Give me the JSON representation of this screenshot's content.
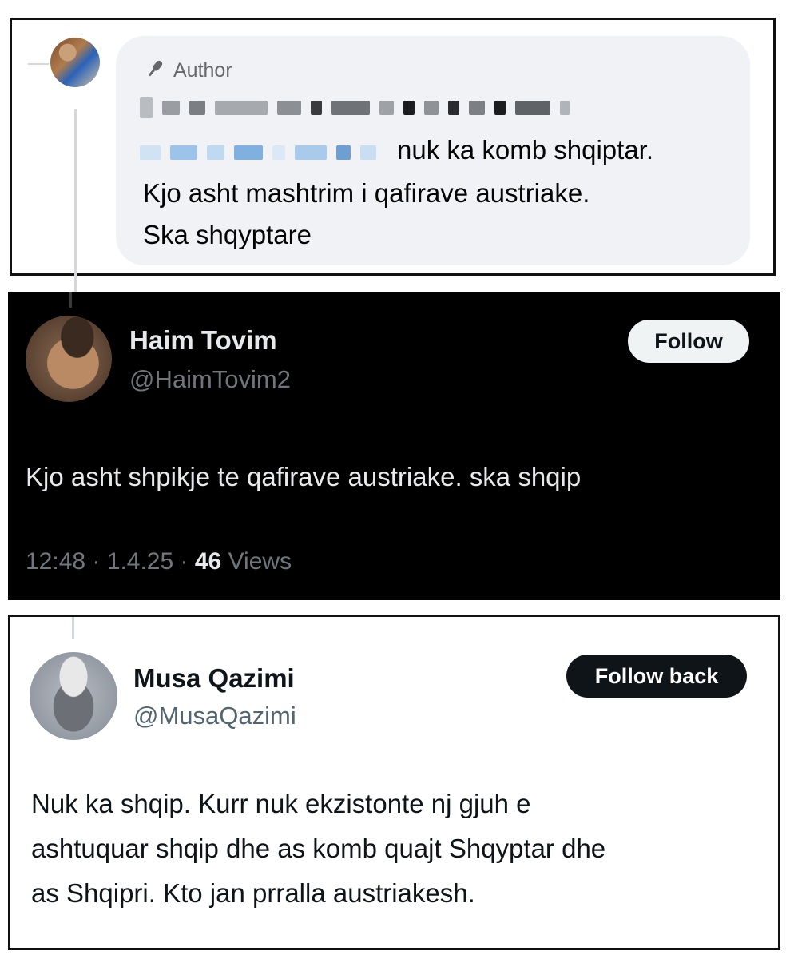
{
  "comment": {
    "badge_label": "Author",
    "badge_icon": "microphone-icon",
    "lines": [
      "nuk ka komb shqiptar.",
      "Kjo asht mashtrim i qafirave austriake.",
      "Ska shqyptare"
    ],
    "bubble_color": "#f0f2f5"
  },
  "tweet1": {
    "name": "Haim Tovim",
    "handle": "@HaimTovim2",
    "follow_label": "Follow",
    "text": "Kjo asht shpikje te qafirave austriake. ska shqip",
    "time": "12:48",
    "date": "1.4.25",
    "views_count": "46",
    "views_label": "Views",
    "separator": "·",
    "theme": "dark"
  },
  "tweet2": {
    "name": "Musa Qazimi",
    "handle": "@MusaQazimi",
    "follow_label": "Follow back",
    "lines": [
      "Nuk ka shqip. Kurr nuk ekzistonte nj gjuh e",
      "ashtuquar shqip dhe as komb quajt Shqyptar dhe",
      "as Shqipri. Kto jan prralla austriakesh."
    ],
    "theme": "light"
  }
}
